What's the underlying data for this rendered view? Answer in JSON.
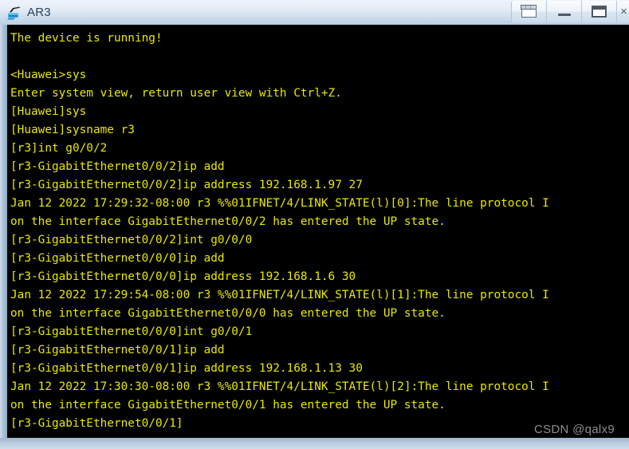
{
  "window": {
    "title": "AR3",
    "icon": "router-icon"
  },
  "titlebar_buttons": [
    {
      "name": "restore-button",
      "icon": "restore-icon",
      "label": ""
    },
    {
      "name": "minimize-button",
      "icon": "minimize-icon",
      "label": ""
    },
    {
      "name": "maximize-button",
      "icon": "maximize-icon",
      "label": ""
    },
    {
      "name": "close-button",
      "icon": "close-icon",
      "label": "×"
    }
  ],
  "terminal": {
    "lines": [
      "The device is running!",
      "",
      "<Huawei>sys",
      "Enter system view, return user view with Ctrl+Z.",
      "[Huawei]sys",
      "[Huawei]sysname r3",
      "[r3]int g0/0/2",
      "[r3-GigabitEthernet0/0/2]ip add",
      "[r3-GigabitEthernet0/0/2]ip address 192.168.1.97 27",
      "Jan 12 2022 17:29:32-08:00 r3 %%01IFNET/4/LINK_STATE(l)[0]:The line protocol I",
      "on the interface GigabitEthernet0/0/2 has entered the UP state.",
      "[r3-GigabitEthernet0/0/2]int g0/0/0",
      "[r3-GigabitEthernet0/0/0]ip add",
      "[r3-GigabitEthernet0/0/0]ip address 192.168.1.6 30",
      "Jan 12 2022 17:29:54-08:00 r3 %%01IFNET/4/LINK_STATE(l)[1]:The line protocol I",
      "on the interface GigabitEthernet0/0/0 has entered the UP state.",
      "[r3-GigabitEthernet0/0/0]int g0/0/1",
      "[r3-GigabitEthernet0/0/1]ip add",
      "[r3-GigabitEthernet0/0/1]ip address 192.168.1.13 30",
      "Jan 12 2022 17:30:30-08:00 r3 %%01IFNET/4/LINK_STATE(l)[2]:The line protocol I",
      "on the interface GigabitEthernet0/0/1 has entered the UP state.",
      "[r3-GigabitEthernet0/0/1]"
    ],
    "text_color": "#e8e800",
    "background_color": "#000000"
  },
  "watermark": {
    "text": "CSDN @qalx9"
  }
}
